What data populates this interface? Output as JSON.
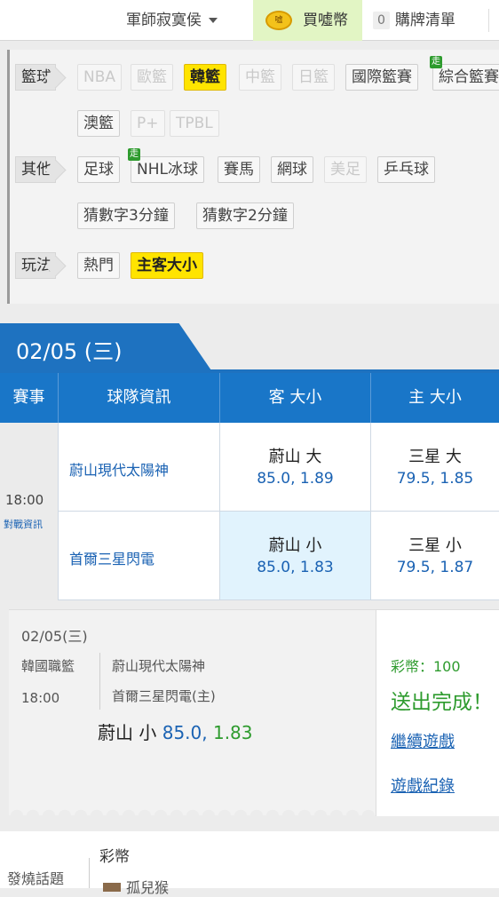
{
  "topbar": {
    "username": "軍師寂寞侯",
    "buy_label": "買噓幣",
    "coin_icon_text": "噓",
    "cart_count": "0",
    "cart_label": "購牌清單"
  },
  "filters": {
    "basketball": {
      "label": "籃球",
      "items": [
        "NBA",
        "歐籃",
        "韓籃",
        "中籃",
        "日籃",
        "國際籃賽",
        "綜合籃賽",
        "澳籃",
        "P+",
        "TPBL"
      ]
    },
    "other": {
      "label": "其他",
      "items": [
        "足球",
        "NHL冰球",
        "賽馬",
        "網球",
        "美足",
        "乒乓球",
        "猜數字3分鐘",
        "猜數字2分鐘"
      ]
    },
    "mode": {
      "label": "玩法",
      "items": [
        "熱門",
        "主客大小"
      ]
    },
    "walk_badge": "走"
  },
  "date_tab": "02/05 (三)",
  "table": {
    "headers": [
      "賽事",
      "球隊資訊",
      "客 大小",
      "主 大小"
    ],
    "time": "18:00",
    "matchup_link": "對戰資訊",
    "rows": [
      {
        "team": "蔚山現代太陽神",
        "away_pick": "蔚山 大",
        "away_odds": "85.0, 1.89",
        "home_pick": "三星 大",
        "home_odds": "79.5, 1.85"
      },
      {
        "team": "首爾三星閃電",
        "away_pick": "蔚山 小",
        "away_odds": "85.0, 1.83",
        "home_pick": "三星 小",
        "home_odds": "79.5, 1.87"
      }
    ]
  },
  "ticket": {
    "date": "02/05(三)",
    "league": "韓國職籃",
    "time": "18:00",
    "team1": "蔚山現代太陽神",
    "team2": "首爾三星閃電(主)",
    "pick_name": "蔚山 小",
    "pick_line": "85.0,",
    "pick_odds": "1.83",
    "coins": "彩幣：100",
    "done": "送出完成！",
    "continue_link": "繼續遊戲",
    "history_link": "遊戲紀錄"
  },
  "bottom": {
    "hot_topics": "發燒話題",
    "coin_label": "彩幣",
    "user_name": "孤兒猴"
  },
  "colors": {
    "accent_blue": "#1976c8",
    "active_yellow": "#ffe400",
    "odds_green": "#2e9b2e",
    "link_blue": "#1a62b3"
  }
}
